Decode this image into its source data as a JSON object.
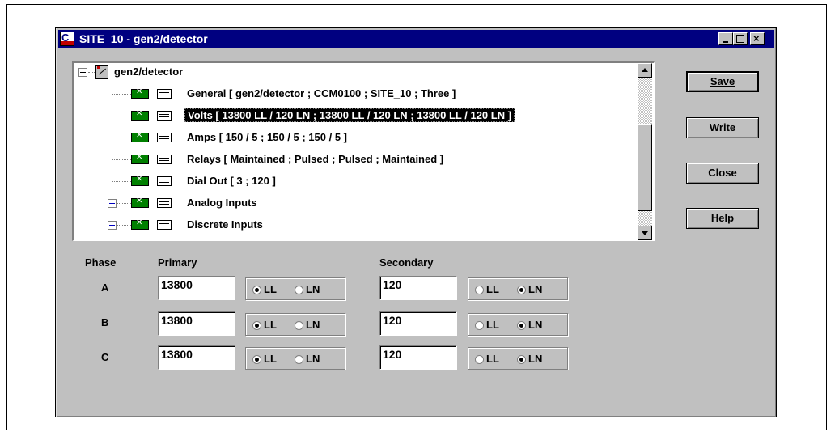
{
  "window": {
    "title": "SITE_10 - gen2/detector",
    "close_glyph": "×"
  },
  "tree": {
    "root_label": "gen2/detector",
    "items": [
      {
        "label": "General  [ gen2/detector ; CCM0100 ; SITE_10 ; Three ]"
      },
      {
        "label": "Volts  [ 13800 LL / 120 LN ; 13800 LL / 120 LN ; 13800 LL / 120 LN ]",
        "selected": true
      },
      {
        "label": "Amps  [ 150 / 5 ; 150 / 5 ; 150 / 5 ]"
      },
      {
        "label": "Relays  [ Maintained ; Pulsed ; Pulsed ; Maintained ]"
      },
      {
        "label": "Dial Out  [ 3 ; 120 ]"
      },
      {
        "label": "Analog Inputs"
      },
      {
        "label": "Discrete Inputs"
      }
    ]
  },
  "buttons": {
    "save": "Save",
    "write": "Write",
    "close": "Close",
    "help": "Help"
  },
  "phase_table": {
    "headers": {
      "phase": "Phase",
      "primary": "Primary",
      "secondary": "Secondary"
    },
    "option_ll": "LL",
    "option_ln": "LN",
    "rows": [
      {
        "phase": "A",
        "primary": "13800",
        "primary_mode": "LL",
        "secondary": "120",
        "secondary_mode": "LN"
      },
      {
        "phase": "B",
        "primary": "13800",
        "primary_mode": "LL",
        "secondary": "120",
        "secondary_mode": "LN"
      },
      {
        "phase": "C",
        "primary": "13800",
        "primary_mode": "LL",
        "secondary": "120",
        "secondary_mode": "LN"
      }
    ]
  }
}
